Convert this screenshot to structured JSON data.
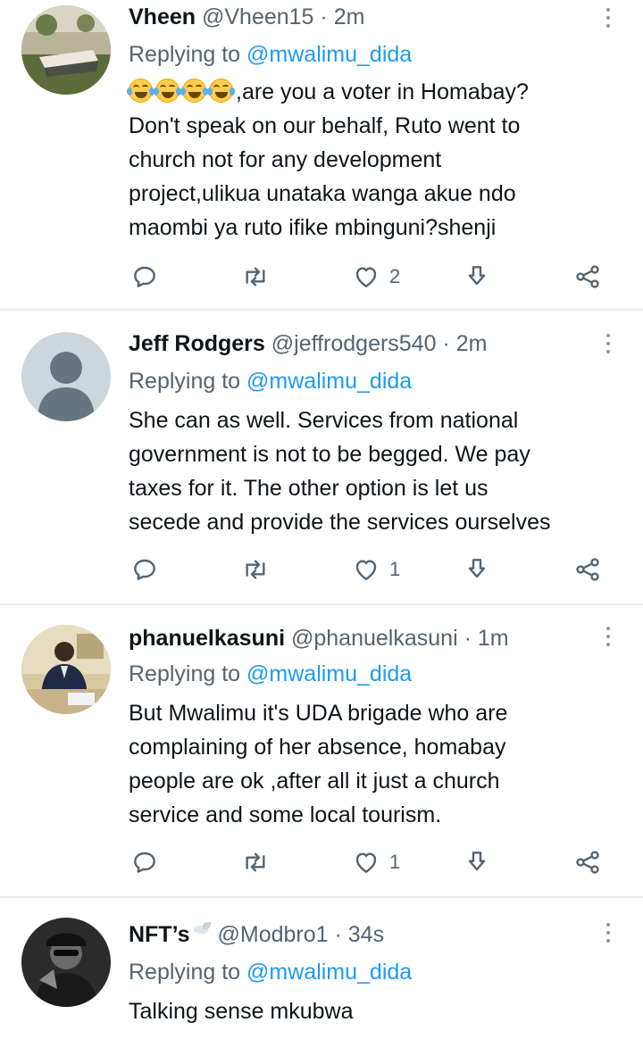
{
  "tweets": [
    {
      "name": "Vheen",
      "handle": "@Vheen15",
      "separator": "·",
      "time": "2m",
      "replying_prefix": "Replying to",
      "replying_to": "@mwalimu_dida",
      "emoji_prefix": "😂😂😂😂",
      "body_lines": [
        ",are you a voter in Homabay?",
        "Don't speak on our behalf, Ruto went to",
        "church not for any development",
        "project,ulikua unataka wanga akue ndo",
        "maombi ya ruto ifike mbinguni?shenji"
      ],
      "likes": "2",
      "avatar_icon": "photo-avatar-outdoor"
    },
    {
      "name": "Jeff Rodgers",
      "handle": "@jeffrodgers540",
      "separator": "·",
      "time": "2m",
      "replying_prefix": "Replying to",
      "replying_to": "@mwalimu_dida",
      "body_lines": [
        "She can as well. Services from national",
        "government is not to be begged. We pay",
        "taxes for it. The other option is let us",
        "secede and provide the services ourselves"
      ],
      "likes": "1",
      "avatar_icon": "default-avatar-icon"
    },
    {
      "name": "phanuelkasuni",
      "handle": "@phanuelkasuni",
      "separator": "·",
      "time": "1m",
      "replying_prefix": "Replying to",
      "replying_to": "@mwalimu_dida",
      "body_lines": [
        "But Mwalimu it's UDA brigade who are",
        "complaining of her absence, homabay",
        "people are ok ,after all it just a church",
        "service and some local tourism."
      ],
      "likes": "1",
      "avatar_icon": "photo-avatar-office"
    },
    {
      "name": "NFT’s",
      "name_emoji": "🕊",
      "handle": "@Modbro1",
      "separator": "·",
      "time": "34s",
      "replying_prefix": "Replying to",
      "replying_to": "@mwalimu_dida",
      "body_lines": [
        "Talking sense mkubwa"
      ],
      "avatar_icon": "photo-avatar-bw"
    }
  ],
  "icons": {
    "reply": "reply-icon",
    "retweet": "retweet-icon",
    "like": "heart-icon",
    "bookmark": "bookmark-icon",
    "share": "share-icon",
    "more": "more-icon"
  },
  "colors": {
    "text": "#0f1419",
    "secondary": "#536471",
    "accent": "#1d9bf0",
    "divider": "#e6ecf0"
  }
}
